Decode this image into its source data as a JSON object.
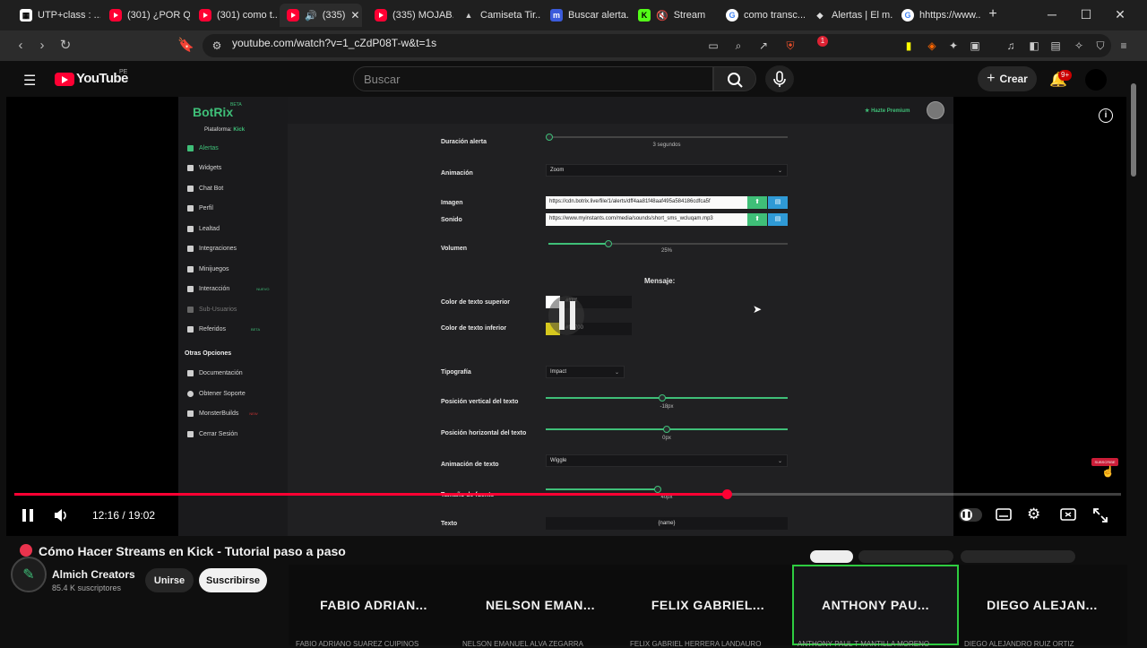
{
  "tabs": [
    {
      "label": "UTP+class : ...",
      "icon": "utp-icon",
      "active": false
    },
    {
      "label": "(301) ¿POR Q...",
      "icon": "youtube-icon",
      "active": false
    },
    {
      "label": "(301) como t...",
      "icon": "youtube-icon",
      "active": false
    },
    {
      "label": "(335)",
      "icon": "youtube-icon",
      "active": true
    },
    {
      "label": "(335) MOJAB...",
      "icon": "youtube-icon",
      "active": false
    },
    {
      "label": "Camiseta Tir...",
      "icon": "adidas-icon",
      "active": false
    },
    {
      "label": "Buscar alerta...",
      "icon": "m-icon",
      "active": false
    },
    {
      "label": "Stream",
      "icon": "kick-icon",
      "active": false
    },
    {
      "label": "como transc...",
      "icon": "google-icon",
      "active": false
    },
    {
      "label": "Alertas | El m...",
      "icon": "diamond-icon",
      "active": false
    },
    {
      "label": "hhttps://www...",
      "icon": "google-icon",
      "active": false
    }
  ],
  "browser": {
    "url": "youtube.com/watch?v=1_cZdP08T-w&t=1s",
    "brave_badge": "1"
  },
  "youtube": {
    "logo": "YouTube",
    "region": "PE",
    "search_placeholder": "Buscar",
    "create_label": "Crear",
    "notif_badge": "9+"
  },
  "botrix": {
    "logo": "BotRix",
    "beta": "BETA",
    "platform_label": "Plataforma:",
    "platform_value": "Kick",
    "premium": "Hazte Premium",
    "nav": [
      {
        "label": "Alertas",
        "badge": ""
      },
      {
        "label": "Widgets",
        "badge": ""
      },
      {
        "label": "Chat Bot",
        "badge": ""
      },
      {
        "label": "Perfil",
        "badge": ""
      },
      {
        "label": "Lealtad",
        "badge": ""
      },
      {
        "label": "Integraciones",
        "badge": ""
      },
      {
        "label": "Minijuegos",
        "badge": ""
      },
      {
        "label": "Interacción",
        "badge": "NUEVO"
      },
      {
        "label": "Sub-Usuarios",
        "badge": ""
      },
      {
        "label": "Referidos",
        "badge": "BETA"
      }
    ],
    "other_title": "Otras Opciones",
    "other": [
      {
        "label": "Documentación",
        "badge": ""
      },
      {
        "label": "Obtener Soporte",
        "badge": ""
      },
      {
        "label": "MonsterBuilds",
        "badge": "NEW"
      },
      {
        "label": "Cerrar Sesión",
        "badge": ""
      }
    ],
    "form": {
      "duracion_label": "Duración alerta",
      "duracion_value": "3 segundos",
      "animacion_label": "Animación",
      "animacion_value": "Zoom",
      "imagen_label": "Imagen",
      "imagen_url": "https://cdn.botrix.live/file/1/alerts/dff4aa81f48aaf495a584186cdfca5f",
      "sonido_label": "Sonido",
      "sonido_url": "https://www.myinstants.com/media/sounds/short_sms_wcluqam.mp3",
      "volumen_label": "Volumen",
      "volumen_value": "25%",
      "volumen_level": 0.25,
      "mensaje_title": "Mensaje:",
      "color_sup_label": "Color de texto superior",
      "color_sup_value": "#ffffff",
      "color_inf_label": "Color de texto inferior",
      "color_inf_value": "#ffd700",
      "tipografia_label": "Tipografía",
      "tipografia_value": "Impact",
      "pos_v_label": "Posición vertical del texto",
      "pos_v_value": "-18px",
      "pos_h_label": "Posición horizontal del texto",
      "pos_h_value": "0px",
      "anim_texto_label": "Animación de texto",
      "anim_texto_value": "Wiggle",
      "tamano_label": "Tamaño de fuente",
      "tamano_value": "40px",
      "texto_label": "Texto",
      "texto_value": "{name}"
    }
  },
  "player": {
    "time": "12:16 / 19:02",
    "progress": 0.644,
    "subscribe_watermark": "SUBSCRIBE"
  },
  "video": {
    "title": "Cómo Hacer Streams en Kick - Tutorial paso a paso",
    "channel": "Almich Creators",
    "subscribers": "85.4 K suscriptores",
    "join_label": "Unirse",
    "subscribe_label": "Suscribirse"
  },
  "participants": [
    {
      "name": "FABIO ADRIAN...",
      "full": "FABIO ADRIANO SUAREZ CUIPINOS"
    },
    {
      "name": "NELSON EMAN...",
      "full": "NELSON EMANUEL ALVA ZEGARRA"
    },
    {
      "name": "FELIX GABRIEL...",
      "full": "FELIX GABRIEL HERRERA LANDAURO"
    },
    {
      "name": "ANTHONY PAU...",
      "full": "ANTHONY PAUL T MANTILLA MORENO"
    },
    {
      "name": "DIEGO ALEJAN...",
      "full": "DIEGO ALEJANDRO RUIZ ORTIZ"
    }
  ]
}
